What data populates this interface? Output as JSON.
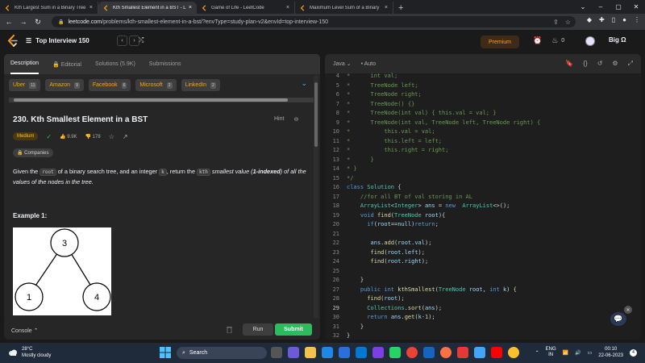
{
  "browser": {
    "tabs": [
      {
        "label": "Kth Largest Sum in a Binary Tree",
        "active": false
      },
      {
        "label": "Kth Smallest Element in a BST - L",
        "active": true
      },
      {
        "label": "Game of Life - LeetCode",
        "active": false
      },
      {
        "label": "Maximum Level Sum of a Binary",
        "active": false
      }
    ],
    "url_domain": "leetcode.com",
    "url_path": "/problems/kth-smallest-element-in-a-bst/?envType=study-plan-v2&envId=top-interview-150"
  },
  "header": {
    "problem_list": "Top Interview 150",
    "premium": "Premium",
    "fire_count": "0",
    "brand": "Big Ω"
  },
  "left_tabs": [
    "Description",
    "Editorial",
    "Solutions (5.9K)",
    "Submissions"
  ],
  "companies": [
    {
      "name": "Uber",
      "count": "11"
    },
    {
      "name": "Amazon",
      "count": "9"
    },
    {
      "name": "Facebook",
      "count": "6"
    },
    {
      "name": "Microsoft",
      "count": "2"
    },
    {
      "name": "LinkedIn",
      "count": "2"
    }
  ],
  "problem": {
    "title": "230. Kth Smallest Element in a BST",
    "hint": "Hint",
    "difficulty": "Medium",
    "likes": "9.9K",
    "dislikes": "178",
    "companies_label": "Companies",
    "desc_1": "Given the ",
    "desc_code1": "root",
    "desc_2": " of a binary search tree, and an integer ",
    "desc_code2": "k",
    "desc_3": ", return the ",
    "desc_kth": "kth",
    "desc_4": " smallest value (",
    "desc_5": "1-indexed",
    "desc_6": ") of all the values of the nodes in the tree.",
    "example_label": "Example 1:",
    "tree_nodes": [
      "3",
      "1",
      "4"
    ]
  },
  "bottom": {
    "console": "Console",
    "run": "Run",
    "submit": "Submit"
  },
  "editor": {
    "language": "Java",
    "mode": "Auto",
    "lines": [
      {
        "n": "4",
        "t": "*      int val;"
      },
      {
        "n": "5",
        "t": "*      TreeNode left;"
      },
      {
        "n": "6",
        "t": "*      TreeNode right;"
      },
      {
        "n": "7",
        "t": "*      TreeNode() {}"
      },
      {
        "n": "8",
        "t": "*      TreeNode(int val) { this.val = val; }"
      },
      {
        "n": "9",
        "t": "*      TreeNode(int val, TreeNode left, TreeNode right) {"
      },
      {
        "n": "10",
        "t": "*          this.val = val;"
      },
      {
        "n": "11",
        "t": "*          this.left = left;"
      },
      {
        "n": "12",
        "t": "*          this.right = right;"
      },
      {
        "n": "13",
        "t": "*      }"
      },
      {
        "n": "14",
        "t": "* }"
      },
      {
        "n": "15",
        "t": "*/"
      },
      {
        "n": "16",
        "t": "class Solution {"
      },
      {
        "n": "17",
        "t": "    //for all BT of val storing in AL"
      },
      {
        "n": "18",
        "t": "    ArrayList<Integer> ans = new  ArrayList<>();"
      },
      {
        "n": "19",
        "t": "    void find(TreeNode root){"
      },
      {
        "n": "20",
        "t": "      if(root==null)return;"
      },
      {
        "n": "21",
        "t": ""
      },
      {
        "n": "22",
        "t": "       ans.add(root.val);"
      },
      {
        "n": "23",
        "t": "       find(root.left);"
      },
      {
        "n": "24",
        "t": "       find(root.right);"
      },
      {
        "n": "25",
        "t": ""
      },
      {
        "n": "26",
        "t": "    }"
      },
      {
        "n": "27",
        "t": "    public int kthSmallest(TreeNode root, int k) {"
      },
      {
        "n": "28",
        "t": "      find(root);"
      },
      {
        "n": "29",
        "t": "      Collections.sort(ans);"
      },
      {
        "n": "30",
        "t": "      return ans.get(k-1);"
      },
      {
        "n": "31",
        "t": "    }"
      },
      {
        "n": "32",
        "t": "}"
      }
    ]
  },
  "taskbar": {
    "temp": "28°C",
    "weather": "Mostly cloudy",
    "search": "Search",
    "lang1": "ENG",
    "lang2": "IN",
    "time": "00:10",
    "date": "22-06-2023",
    "notif": "4"
  },
  "colors": {
    "accent": "#ffa116",
    "submit": "#2cbb5d",
    "medium": "#ffc01e"
  }
}
